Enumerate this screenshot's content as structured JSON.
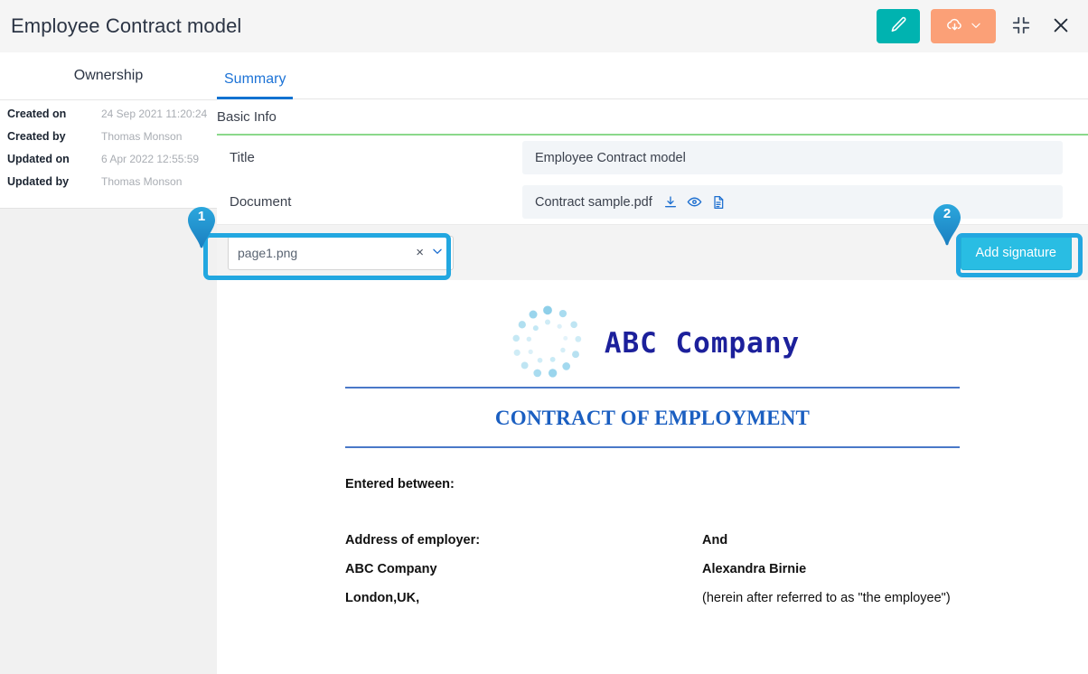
{
  "window": {
    "title": "Employee Contract model",
    "actions": [
      {
        "name": "edit-button",
        "icon": "pencil-icon",
        "color": "#00b3b0"
      },
      {
        "name": "download-button",
        "icon": "cloud-download-icon",
        "color": "#fba077"
      },
      {
        "name": "collapse-button",
        "icon": "collapse-icon"
      },
      {
        "name": "close-button",
        "icon": "close-icon"
      }
    ]
  },
  "ownership": {
    "header": "Ownership",
    "rows": [
      {
        "label": "Created on",
        "value": "24 Sep 2021 11:20:24"
      },
      {
        "label": "Created by",
        "value": "Thomas Monson"
      },
      {
        "label": "Updated on",
        "value": "6 Apr 2022 12:55:59"
      },
      {
        "label": "Updated by",
        "value": "Thomas Monson"
      }
    ]
  },
  "tabs": [
    {
      "label": "Summary",
      "active": true
    }
  ],
  "basic_info": {
    "section_title": "Basic Info",
    "fields": [
      {
        "label": "Title",
        "value": "Employee Contract model"
      },
      {
        "label": "Document",
        "value": "Contract sample.pdf"
      }
    ],
    "document_icons": [
      "download-icon",
      "eye-icon",
      "file-icon"
    ]
  },
  "toolbar": {
    "page_select_value": "page1.png",
    "page_select_clear": "×",
    "add_signature_label": "Add signature"
  },
  "document_preview": {
    "logo_text": "ABC Company",
    "heading": "CONTRACT OF EMPLOYMENT",
    "entered_between": "Entered between:",
    "employer_label": "Address of employer:",
    "employer_name": "ABC Company",
    "employer_city": "London,UK,",
    "and_label": "And",
    "employee_name": "Alexandra Birnie",
    "employee_note": "(herein after referred to as \"the employee\")"
  },
  "annotations": [
    {
      "number": "1",
      "target": "page-select"
    },
    {
      "number": "2",
      "target": "add-signature-button"
    }
  ],
  "colors": {
    "accent_blue": "#1272d1",
    "annotation_cyan": "#22a7e0",
    "teal": "#00b3b0",
    "orange": "#fba077",
    "green_divider": "#8bd98b",
    "signature_cyan": "#29bde3",
    "doc_blue": "#1b5fc1",
    "logo_navy": "#1c209b"
  }
}
